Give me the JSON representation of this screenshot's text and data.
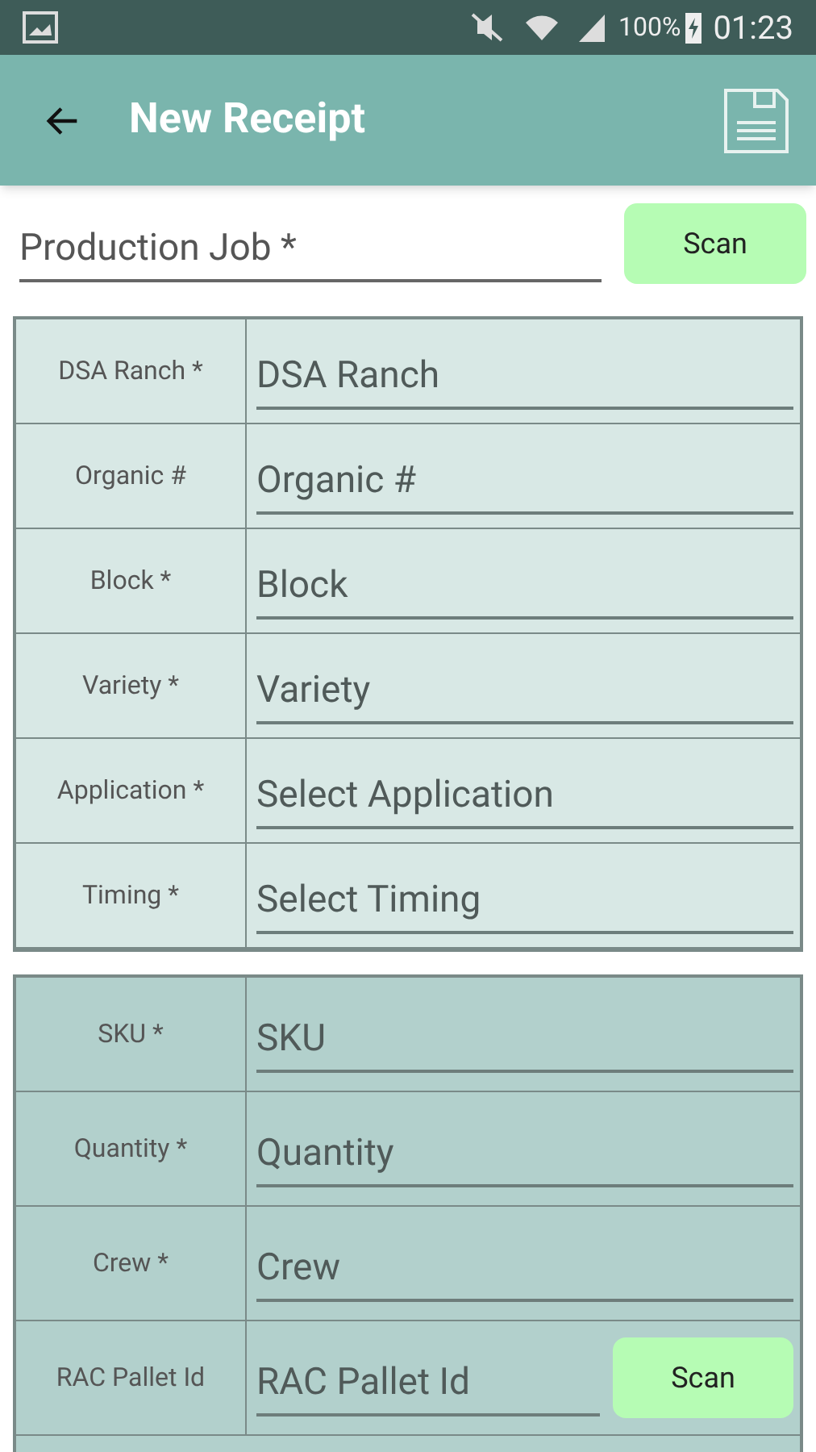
{
  "status_bar": {
    "battery": "100%",
    "time": "01:23"
  },
  "app_bar": {
    "title": "New Receipt"
  },
  "production_job": {
    "placeholder": "Production Job *",
    "button": "Scan"
  },
  "sections": [
    {
      "kind": "light",
      "rows": [
        {
          "label": "DSA Ranch *",
          "placeholder": "DSA Ranch"
        },
        {
          "label": "Organic #",
          "placeholder": "Organic #"
        },
        {
          "label": "Block *",
          "placeholder": "Block"
        },
        {
          "label": "Variety *",
          "placeholder": "Variety"
        },
        {
          "label": "Application *",
          "placeholder": "Select Application"
        },
        {
          "label": "Timing *",
          "placeholder": "Select Timing"
        }
      ]
    },
    {
      "kind": "dark",
      "rows": [
        {
          "label": "SKU *",
          "placeholder": "SKU"
        },
        {
          "label": "Quantity *",
          "placeholder": "Quantity"
        },
        {
          "label": "Crew *",
          "placeholder": "Crew"
        },
        {
          "label": "RAC Pallet Id",
          "placeholder": "RAC Pallet Id",
          "button": "Scan"
        }
      ]
    }
  ]
}
